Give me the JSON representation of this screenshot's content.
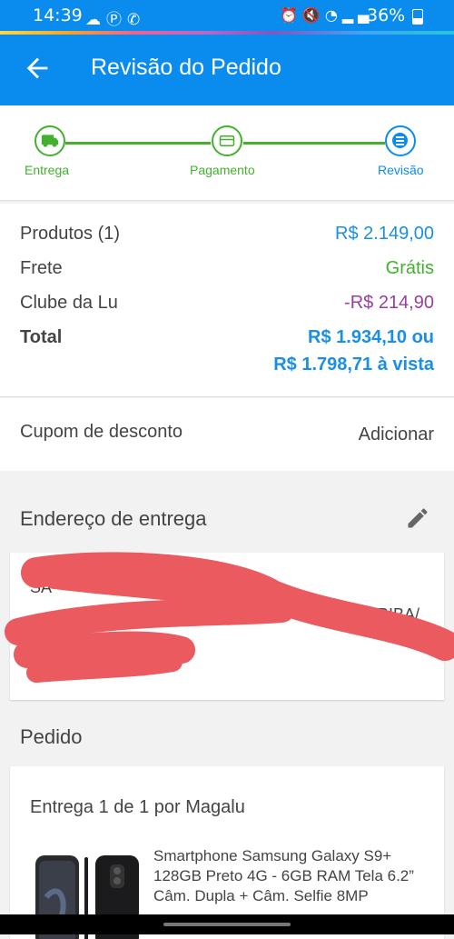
{
  "status_bar": {
    "time": "14:39",
    "battery": "36%",
    "left_icons": [
      "cloud-icon",
      "pinterest-icon",
      "whatsapp-icon"
    ],
    "right_icons": [
      "alarm-icon",
      "mute-icon",
      "wifi-icon",
      "signal-icon",
      "battery-icon"
    ]
  },
  "app_bar": {
    "title": "Revisão do Pedido",
    "back_icon": "arrow-back-icon"
  },
  "stepper": {
    "steps": [
      {
        "label": "Entrega",
        "icon": "truck-icon",
        "state": "done"
      },
      {
        "label": "Pagamento",
        "icon": "card-icon",
        "state": "done"
      },
      {
        "label": "Revisão",
        "icon": "list-icon",
        "state": "current"
      }
    ],
    "done_color": "#43b12e",
    "current_color": "#0a8cef"
  },
  "summary": {
    "products_label": "Produtos (1)",
    "products_value": "R$ 2.149,00",
    "shipping_label": "Frete",
    "shipping_value": "Grátis",
    "club_label": "Clube da Lu",
    "club_value": "-R$ 214,90",
    "total_label": "Total",
    "total_value_line1": "R$ 1.934,10 ou",
    "total_value_line2": "R$ 1.798,71 à vista"
  },
  "coupon": {
    "label": "Cupom de desconto",
    "action": "Adicionar"
  },
  "address": {
    "title": "Endereço de entrega",
    "edit_icon": "pencil-icon",
    "visible_fragments": [
      "SA",
      "RIBA/"
    ]
  },
  "order": {
    "title": "Pedido",
    "shipment": "Entrega 1 de 1 por Magalu",
    "product_name": "Smartphone Samsung Galaxy S9+ 128GB Preto 4G - 6GB RAM Tela 6.2” Câm. Dupla + Câm. Selfie 8MP"
  },
  "colors": {
    "primary_blue": "#0a8cef",
    "price_blue": "#1a8fe3",
    "green": "#43b12e",
    "purple": "#9a3f9c",
    "redaction": "#ea5a5e"
  }
}
